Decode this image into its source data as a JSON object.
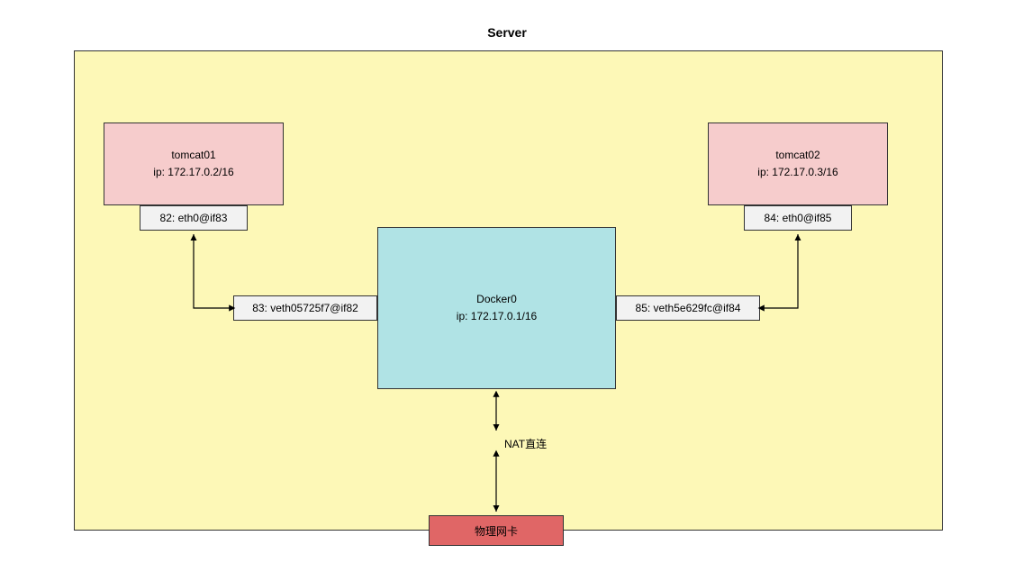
{
  "diagram": {
    "title": "Server",
    "containers": {
      "tomcat01": {
        "name": "tomcat01",
        "ip": "ip: 172.17.0.2/16",
        "eth": "82: eth0@if83"
      },
      "tomcat02": {
        "name": "tomcat02",
        "ip": "ip: 172.17.0.3/16",
        "eth": "84: eth0@if85"
      }
    },
    "bridge": {
      "name": "Docker0",
      "ip": "ip:  172.17.0.1/16",
      "veths": {
        "veth1": "83: veth05725f7@if82",
        "veth2": "85: veth5e629fc@if84"
      }
    },
    "nat_label": "NAT直连",
    "physical_nic": "物理网卡"
  }
}
